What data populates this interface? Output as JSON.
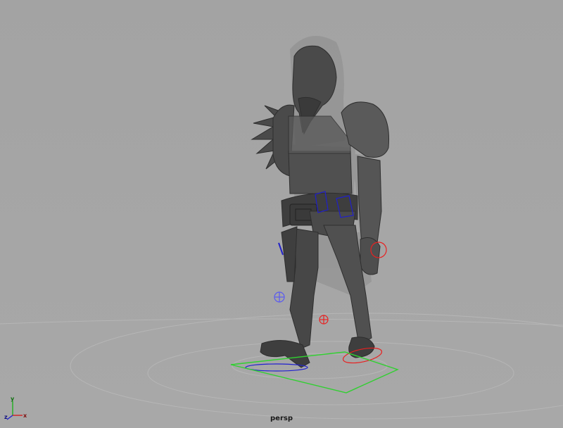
{
  "viewport": {
    "camera_name": "persp",
    "background_color": "#a6a6a6",
    "axis_gizmo": {
      "y_label": "y",
      "z_label": "z",
      "x_label": "x"
    },
    "character": {
      "body_color": "#4a4a4a",
      "ghost_mesh_color": "#8a8a8a"
    },
    "controls": {
      "hand_ik_color": "#e82020",
      "knee_pole_left_color": "#5a5af0",
      "knee_pole_right_color": "#e82020",
      "foot_ik_left_color": "#2020d0",
      "foot_ik_right_color": "#e82020",
      "hip_controls_color": "#2020c8",
      "root_control_color": "#30d030"
    },
    "grid_color": "#b8b8b8"
  }
}
